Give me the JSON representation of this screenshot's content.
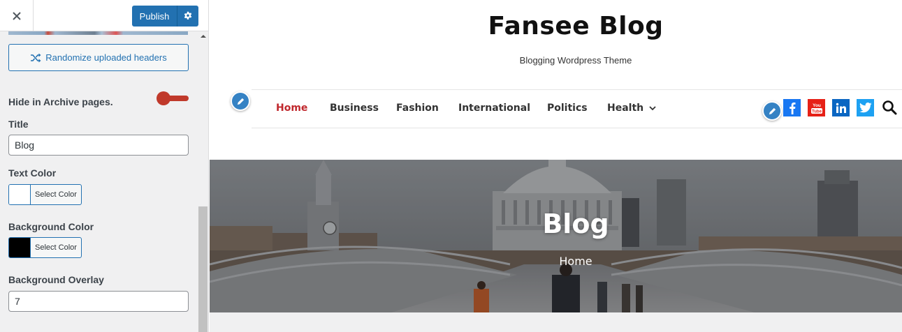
{
  "sidebar": {
    "publish_label": "Publish",
    "randomize_label": "Randomize uploaded headers",
    "hide_archive_label": "Hide in Archive pages.",
    "title_label": "Title",
    "title_value": "Blog",
    "text_color_label": "Text Color",
    "text_color_button": "Select Color",
    "text_color_value": "#ffffff",
    "bg_color_label": "Background Color",
    "bg_color_button": "Select Color",
    "bg_color_value": "#000000",
    "overlay_label": "Background Overlay",
    "overlay_value": "7",
    "toggle_color": "#c0392b"
  },
  "site": {
    "title": "Fansee Blog",
    "tagline": "Blogging Wordpress Theme"
  },
  "nav": {
    "items": [
      "Home",
      "Business",
      "Fashion",
      "International",
      "Politics",
      "Health"
    ],
    "active_color": "#c0282d"
  },
  "social": [
    {
      "icon": "facebook-icon",
      "color": "#1877f2"
    },
    {
      "icon": "youtube-icon",
      "color": "#e62117"
    },
    {
      "icon": "linkedin-icon",
      "color": "#0a66c2"
    },
    {
      "icon": "twitter-icon",
      "color": "#1da1f2"
    }
  ],
  "banner": {
    "title": "Blog",
    "breadcrumb": "Home"
  },
  "colors": {
    "wp_blue": "#2271b1",
    "edit_badge": "#3582c4"
  }
}
